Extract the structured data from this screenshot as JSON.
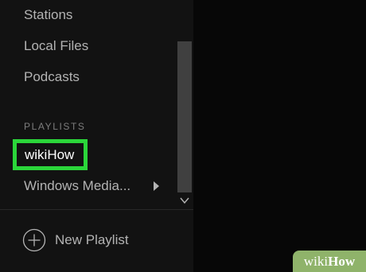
{
  "sidebar": {
    "nav": {
      "stations": "Stations",
      "local_files": "Local Files",
      "podcasts": "Podcasts"
    },
    "playlists_header": "PLAYLISTS",
    "playlists": [
      {
        "label": "wikiHow",
        "highlighted": true
      },
      {
        "label": "Windows Media...",
        "has_submenu": true
      }
    ],
    "new_playlist": "New Playlist"
  },
  "watermark": {
    "part1": "wiki",
    "part2": "How"
  },
  "colors": {
    "highlight": "#2bd63a",
    "sidebar_bg": "#121212",
    "main_bg": "#070707",
    "text_muted": "#b3b3b3",
    "text_active": "#ffffff",
    "watermark_bg": "#8fb36a"
  },
  "icons": {
    "submenu": "caret-right-icon",
    "scroll_down": "chevron-down-icon",
    "new_playlist": "plus-circle-icon"
  }
}
